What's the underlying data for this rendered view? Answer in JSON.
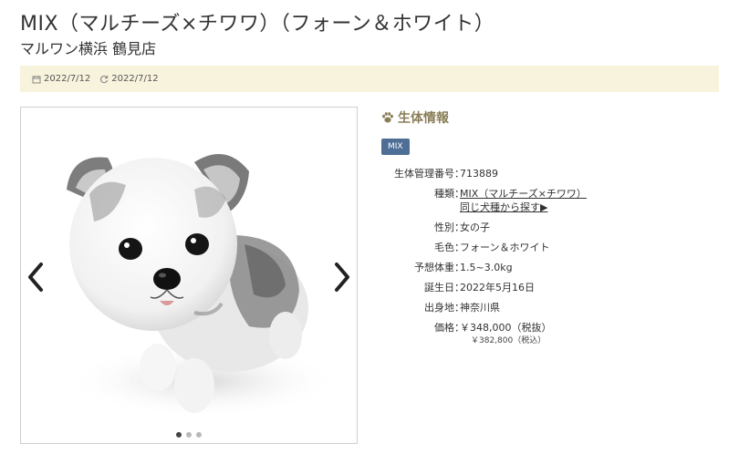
{
  "header": {
    "title": "MIX（マルチーズ×チワワ）（フォーン＆ホワイト）",
    "store": "マルワン横浜 鶴見店"
  },
  "dates": {
    "posted": "2022/7/12",
    "updated": "2022/7/12"
  },
  "gallery": {
    "slide_count": 3,
    "active_index": 0
  },
  "info": {
    "heading": "生体情報",
    "badge": "MIX",
    "id_label": "生体管理番号",
    "id_value": "713889",
    "breed_label": "種類",
    "breed_value": "MIX（マルチーズ×チワワ）",
    "breed_link": "同じ犬種から探す▶",
    "sex_label": "性別",
    "sex_value": "女の子",
    "color_label": "毛色",
    "color_value": "フォーン＆ホワイト",
    "weight_label": "予想体重",
    "weight_value": "1.5~3.0kg",
    "birth_label": "誕生日",
    "birth_value": "2022年5月16日",
    "origin_label": "出身地",
    "origin_value": "神奈川県",
    "price_label": "価格",
    "price_value": "￥348,000（税抜）",
    "price_tax": "￥382,800（税込）"
  },
  "colors": {
    "datebar_bg": "#f7f3dd",
    "badge_bg": "#4f6e96",
    "heading": "#8a7e58"
  }
}
